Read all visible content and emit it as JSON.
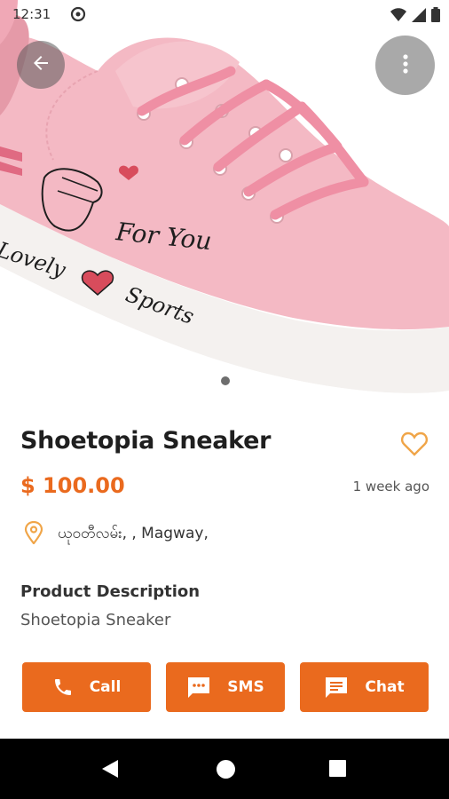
{
  "status_bar": {
    "time": "12:31"
  },
  "product": {
    "image_text": {
      "line1": "For You",
      "line2": "Lovely",
      "line3": "Sports"
    },
    "title": "Shoetopia Sneaker",
    "price": "$ 100.00",
    "posted": "1 week ago",
    "location": "ယုဝတီလမ်း, , Magway,",
    "description_label": "Product Description",
    "description": "Shoetopia Sneaker"
  },
  "actions": {
    "call": "Call",
    "sms": "SMS",
    "chat": "Chat"
  },
  "colors": {
    "accent": "#ea6a1e",
    "shoe": "#f4b9c4"
  }
}
